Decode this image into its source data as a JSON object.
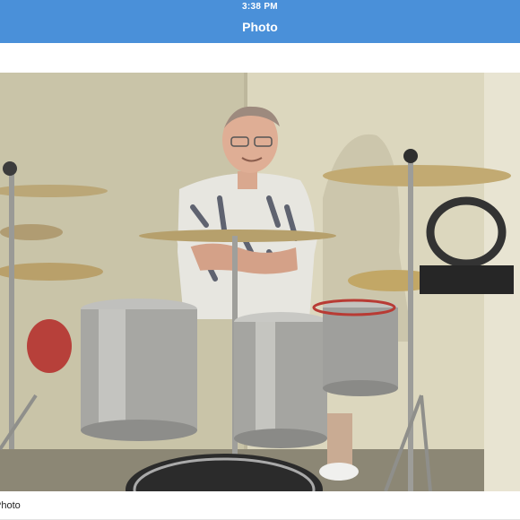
{
  "status_bar": {
    "time": "3:38 PM"
  },
  "nav": {
    "title": "Photo"
  },
  "photo": {
    "subject": "man-behind-drum-kit",
    "colors": {
      "wall": "#d6d1b6",
      "shirt": "#e9e9e4",
      "drum": "#a9a9a6",
      "cymbal": "#c2a96a"
    }
  },
  "caption": {
    "text": "Photo"
  },
  "colors": {
    "header": "#4a90d9",
    "background": "#ffffff"
  }
}
